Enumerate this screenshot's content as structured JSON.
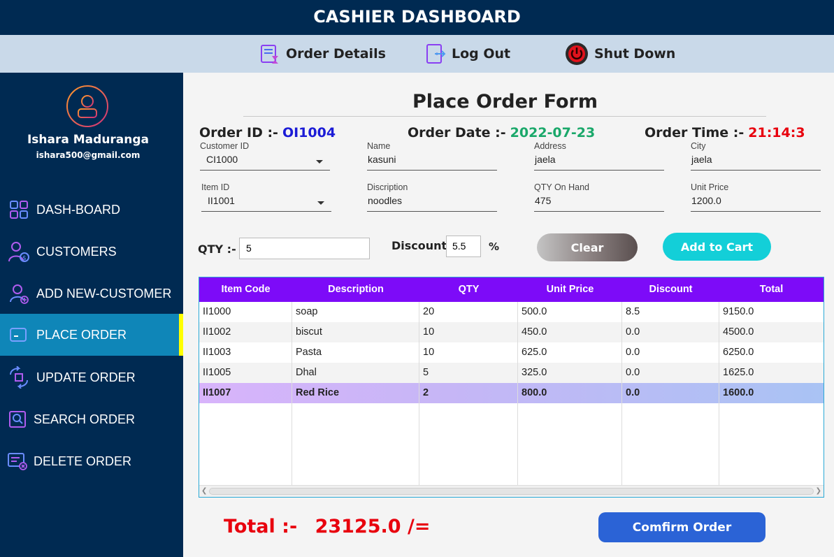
{
  "header": {
    "title": "CASHIER DASHBOARD"
  },
  "toolbar": {
    "order_details": "Order Details",
    "log_out": "Log Out",
    "shut_down": "Shut Down"
  },
  "user": {
    "name": "Ishara Maduranga",
    "email": "ishara500@gmail.com"
  },
  "sidebar": {
    "items": [
      {
        "label": "DASH-BOARD",
        "icon": "dashboard-icon"
      },
      {
        "label": "CUSTOMERS",
        "icon": "customers-icon"
      },
      {
        "label": "ADD NEW-CUSTOMER",
        "icon": "add-customer-icon"
      },
      {
        "label": "PLACE ORDER",
        "icon": "place-order-icon",
        "active": true
      },
      {
        "label": "UPDATE ORDER",
        "icon": "update-order-icon"
      },
      {
        "label": "SEARCH ORDER",
        "icon": "search-order-icon"
      },
      {
        "label": "DELETE ORDER",
        "icon": "delete-order-icon"
      }
    ]
  },
  "form": {
    "title": "Place Order Form",
    "order_id_label": "Order ID :-",
    "order_id": "OI1004",
    "order_date_label": "Order Date :-",
    "order_date": "2022-07-23",
    "order_time_label": "Order Time :-",
    "order_time": "21:14:3",
    "customer_id_label": "Customer ID",
    "customer_id": "CI1000",
    "name_label": "Name",
    "name": "kasuni",
    "address_label": "Address",
    "address": "jaela",
    "city_label": "City",
    "city": "jaela",
    "item_id_label": "Item ID",
    "item_id": "II1001",
    "description_label": "Discription",
    "description": "noodles",
    "qty_on_hand_label": "QTY On Hand",
    "qty_on_hand": "475",
    "unit_price_label": "Unit Price",
    "unit_price": "1200.0",
    "qty_label": "QTY :-",
    "qty": "5",
    "discount_label": "Discount",
    "discount": "5.5",
    "percent": "%",
    "clear_label": "Clear",
    "add_to_cart_label": "Add to Cart"
  },
  "table": {
    "columns": [
      "Item Code",
      "Description",
      "QTY",
      "Unit Price",
      "Discount",
      "Total"
    ],
    "rows": [
      [
        "II1000",
        "soap",
        "20",
        "500.0",
        "8.5",
        "9150.0"
      ],
      [
        "II1002",
        "biscut",
        "10",
        "450.0",
        "0.0",
        "4500.0"
      ],
      [
        "II1003",
        "Pasta",
        "10",
        "625.0",
        "0.0",
        "6250.0"
      ],
      [
        "II1005",
        "Dhal",
        "5",
        "325.0",
        "0.0",
        "1625.0"
      ],
      [
        "II1007",
        "Red Rice",
        "2",
        "800.0",
        "0.0",
        "1600.0"
      ]
    ],
    "selected_row": 4
  },
  "footer": {
    "total_label": "Total :-",
    "total_value": "23125.0 /=",
    "confirm_label": "Comfirm Order"
  },
  "colors": {
    "navy": "#002a52",
    "accent_purple": "#7d0bf8",
    "active_nav": "#0f86b8",
    "cyan_button": "#13cfd8",
    "blue_button": "#2b63d6",
    "total_red": "#e8000d"
  }
}
